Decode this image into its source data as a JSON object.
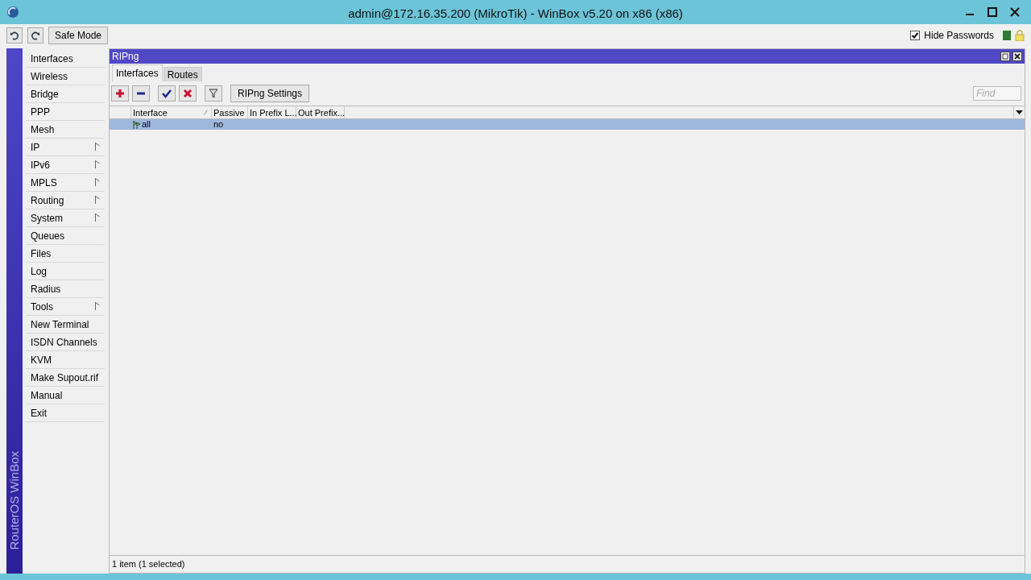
{
  "window": {
    "title": "admin@172.16.35.200 (MikroTik) - WinBox v5.20 on x86 (x86)"
  },
  "toolbar": {
    "safe_mode": "Safe Mode",
    "hide_passwords": {
      "label": "Hide Passwords",
      "checked": true
    }
  },
  "side_label": "RouterOS WinBox",
  "sidebar": {
    "items": [
      {
        "label": "Interfaces",
        "submenu": false
      },
      {
        "label": "Wireless",
        "submenu": false
      },
      {
        "label": "Bridge",
        "submenu": false
      },
      {
        "label": "PPP",
        "submenu": false
      },
      {
        "label": "Mesh",
        "submenu": false
      },
      {
        "label": "IP",
        "submenu": true
      },
      {
        "label": "IPv6",
        "submenu": true
      },
      {
        "label": "MPLS",
        "submenu": true
      },
      {
        "label": "Routing",
        "submenu": true
      },
      {
        "label": "System",
        "submenu": true
      },
      {
        "label": "Queues",
        "submenu": false
      },
      {
        "label": "Files",
        "submenu": false
      },
      {
        "label": "Log",
        "submenu": false
      },
      {
        "label": "Radius",
        "submenu": false
      },
      {
        "label": "Tools",
        "submenu": true
      },
      {
        "label": "New Terminal",
        "submenu": false
      },
      {
        "label": "ISDN Channels",
        "submenu": false
      },
      {
        "label": "KVM",
        "submenu": false
      },
      {
        "label": "Make Supout.rif",
        "submenu": false
      },
      {
        "label": "Manual",
        "submenu": false
      },
      {
        "label": "Exit",
        "submenu": false
      }
    ]
  },
  "panel": {
    "title": "RIPng",
    "tabs": [
      {
        "label": "Interfaces",
        "selected": true
      },
      {
        "label": "Routes",
        "selected": false
      }
    ],
    "settings_button": "RIPng Settings",
    "find": {
      "placeholder": "Find"
    },
    "table": {
      "columns": [
        "Interface",
        "Passive",
        "In Prefix L...",
        "Out Prefix..."
      ],
      "rows": [
        {
          "cells": [
            "all",
            "no",
            "",
            ""
          ],
          "selected": true
        }
      ]
    },
    "status": "1 item (1 selected)"
  }
}
